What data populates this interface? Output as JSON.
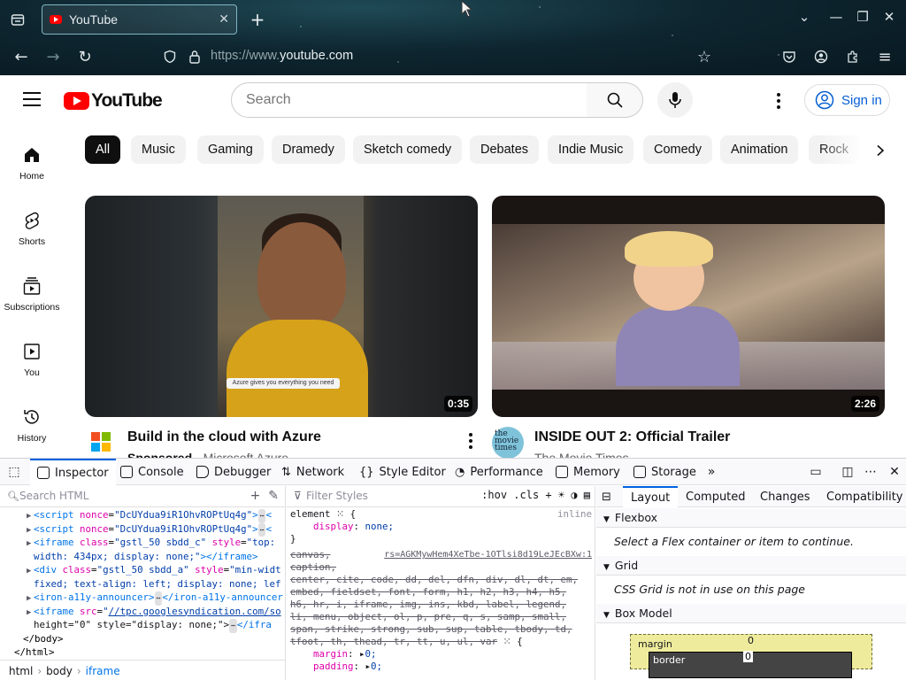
{
  "browser": {
    "tab_title": "YouTube",
    "tab_close": "✕",
    "new_tab": "+",
    "url_prefix": "https://www.",
    "url_domain": "youtube.com",
    "window_controls": [
      "⌄",
      "—",
      "❐",
      "✕"
    ]
  },
  "youtube": {
    "logo_text": "YouTube",
    "search_placeholder": "Search",
    "sign_in": "Sign in",
    "sidebar": [
      {
        "label": "Home",
        "icon": "home-icon"
      },
      {
        "label": "Shorts",
        "icon": "shorts-icon"
      },
      {
        "label": "Subscriptions",
        "icon": "subscriptions-icon"
      },
      {
        "label": "You",
        "icon": "you-icon"
      },
      {
        "label": "History",
        "icon": "history-icon"
      }
    ],
    "chips": [
      "All",
      "Music",
      "Gaming",
      "Dramedy",
      "Sketch comedy",
      "Debates",
      "Indie Music",
      "Comedy",
      "Animation",
      "Rock"
    ],
    "videos": [
      {
        "title": "Build in the cloud with Azure",
        "duration": "0:35",
        "sponsored": "Sponsored",
        "channel": "Microsoft Azure",
        "thumb_caption": "Azure gives you everything you need"
      },
      {
        "title": "INSIDE OUT 2: Official Trailer",
        "duration": "2:26",
        "channel": "The Movie Times",
        "avatar_text": "the movie times"
      }
    ],
    "colors": {
      "brand_red": "#ff0000",
      "link_blue": "#065fd4"
    }
  },
  "devtools": {
    "tabs": [
      "Inspector",
      "Console",
      "Debugger",
      "Network",
      "Style Editor",
      "Performance",
      "Memory",
      "Storage"
    ],
    "search_html_placeholder": "Search HTML",
    "filter_styles_placeholder": "Filter Styles",
    "rules_options": ":hov .cls",
    "breadcrumbs": [
      "html",
      "body",
      "iframe"
    ],
    "markup": {
      "l1_nonce": "DcUYdua9iR1OhvROPtUq4g",
      "l2_nonce": "DcUYdua9iR1OhvROPtUq4g",
      "l3_class": "gstl_50 sbdd_c",
      "l3_style": "top:",
      "l3b": "width: 434px; display: none;",
      "l4_class": "gstl_50 sbdd_a",
      "l4_style": "min-widt",
      "l4b": "fixed; text-align: left; display: none; lef",
      "l5_tag": "iron-a11y-announcer",
      "l6_src": "//tpc.googlesyndication.com/so",
      "l6b": "height=\"0\" style=\"display: none;\">",
      "close_body": "</body>",
      "close_html": "</html>"
    },
    "rules": {
      "element_selector": "element",
      "inline_label": "inline",
      "rule1_prop": "display",
      "rule1_val": "none;",
      "ua_source": "rs=AGKMywHem4XeTbe-1OTlsi8d19LeJEcBXw:1",
      "ua_lines": [
        "canvas,",
        "caption,",
        "center, cite, code, dd, del, dfn, div, dl, dt, em,",
        "embed, fieldset, font, form, h1, h2, h3, h4, h5,",
        "h6, hr, i, iframe, img, ins, kbd, label, legend,",
        "li, menu, object, ol, p, pre, q, s, samp, small,",
        "span, strike, strong, sub, sup, table, tbody, td,",
        "tfoot, th, thead, tr, tt, u, ul, var"
      ],
      "margin_prop": "margin",
      "margin_val": "0;",
      "padding_prop": "padding",
      "padding_val": "0;"
    },
    "layout_tabs": [
      "Layout",
      "Computed",
      "Changes",
      "Compatibility"
    ],
    "sections": [
      {
        "title": "Flexbox",
        "message": "Select a Flex container or item to continue."
      },
      {
        "title": "Grid",
        "message": "CSS Grid is not in use on this page"
      },
      {
        "title": "Box Model",
        "message": ""
      }
    ],
    "box_model": {
      "margin_label": "margin",
      "margin_top": "0",
      "border_label": "border",
      "border_top": "0"
    }
  }
}
